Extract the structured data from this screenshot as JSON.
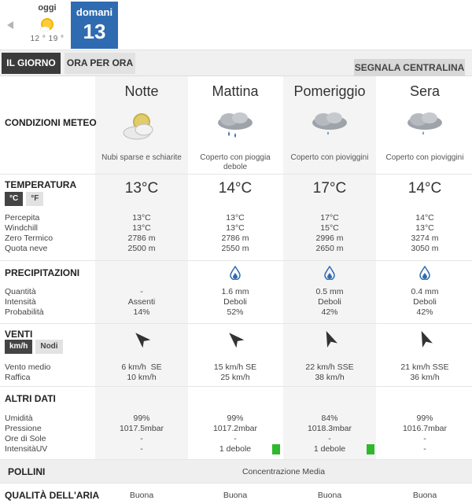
{
  "day_selector": {
    "today": {
      "label": "oggi",
      "icon": "sun-cloud-icon",
      "temps": "12 ° 19 °"
    },
    "selected": {
      "label": "domani",
      "number": "13"
    }
  },
  "tabs": {
    "day": "IL GIORNO",
    "hour": "ORA PER ORA",
    "report": "SEGNALA CENTRALINA"
  },
  "periods": [
    {
      "name": "Notte",
      "icon": "partly-cloudy-night-icon",
      "condition": "Nubi sparse e schiarite",
      "temp": "13°C",
      "percepita": "13°C",
      "windchill": "13°C",
      "zero_termico": "2786 m",
      "quota_neve": "2500 m",
      "precip_icon": "",
      "quantita": "-",
      "intensita": "Assenti",
      "probabilita": "14%",
      "wind_dir_deg": 315,
      "vento_medio": "6 km/h  SE",
      "raffica": "10 km/h",
      "umidita": "99%",
      "pressione": "1017.5mbar",
      "ore_sole": "-",
      "uv": "-",
      "uv_bar": false,
      "aria": "Buona"
    },
    {
      "name": "Mattina",
      "icon": "cloud-rain-icon",
      "condition": "Coperto con pioggia debole",
      "temp": "14°C",
      "percepita": "13°C",
      "windchill": "13°C",
      "zero_termico": "2786 m",
      "quota_neve": "2550 m",
      "precip_icon": "drop-icon",
      "quantita": "1.6 mm",
      "intensita": "Deboli",
      "probabilita": "52%",
      "wind_dir_deg": 315,
      "vento_medio": "15 km/h SE",
      "raffica": "25 km/h",
      "umidita": "99%",
      "pressione": "1017.2mbar",
      "ore_sole": "-",
      "uv": "1 debole",
      "uv_bar": true,
      "aria": "Buona"
    },
    {
      "name": "Pomeriggio",
      "icon": "cloud-drizzle-icon",
      "condition": "Coperto con pioviggini",
      "temp": "17°C",
      "percepita": "17°C",
      "windchill": "15°C",
      "zero_termico": "2996 m",
      "quota_neve": "2650 m",
      "precip_icon": "drop-icon",
      "quantita": "0.5 mm",
      "intensita": "Deboli",
      "probabilita": "42%",
      "wind_dir_deg": 337,
      "vento_medio": "22 km/h SSE",
      "raffica": "38 km/h",
      "umidita": "84%",
      "pressione": "1018.3mbar",
      "ore_sole": "-",
      "uv": "1 debole",
      "uv_bar": true,
      "aria": "Buona"
    },
    {
      "name": "Sera",
      "icon": "cloud-drizzle-icon",
      "condition": "Coperto con pioviggini",
      "temp": "14°C",
      "percepita": "14°C",
      "windchill": "13°C",
      "zero_termico": "3274 m",
      "quota_neve": "3050 m",
      "precip_icon": "drop-icon",
      "quantita": "0.4 mm",
      "intensita": "Deboli",
      "probabilita": "42%",
      "wind_dir_deg": 337,
      "vento_medio": "21 km/h SSE",
      "raffica": "36 km/h",
      "umidita": "99%",
      "pressione": "1016.7mbar",
      "ore_sole": "-",
      "uv": "-",
      "uv_bar": false,
      "aria": "Buona"
    }
  ],
  "labels": {
    "condizioni": "CONDIZIONI METEO",
    "temperatura": "TEMPERATURA",
    "celsius": "°C",
    "fahrenheit": "°F",
    "percepita": "Percepita",
    "windchill": "Windchill",
    "zero_termico": "Zero Termico",
    "quota_neve": "Quota neve",
    "precipitazioni": "PRECIPITAZIONI",
    "quantita": "Quantità",
    "intensita": "Intensità",
    "probabilita": "Probabilità",
    "venti": "VENTI",
    "kmh": "km/h",
    "nodi": "Nodi",
    "vento_medio": "Vento medio",
    "raffica": "Raffica",
    "altri_dati": "ALTRI DATI",
    "umidita": "Umidità",
    "pressione": "Pressione",
    "ore_sole": "Ore di Sole",
    "uv": "IntensitàUV",
    "pollini": "POLLINI",
    "pollini_value": "Concentrazione Media",
    "aria": "QUALITÀ DELL'ARIA"
  },
  "colors": {
    "selected_day": "#2f6bb1",
    "uv_low": "#2eb82e",
    "drop": "#2f6bb1",
    "arrow": "#333333"
  }
}
